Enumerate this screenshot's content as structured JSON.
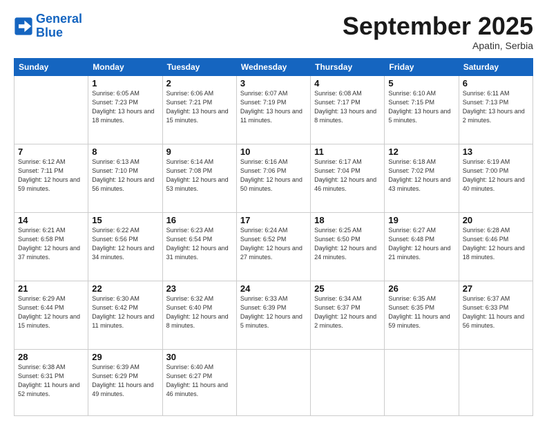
{
  "logo": {
    "line1": "General",
    "line2": "Blue"
  },
  "title": "September 2025",
  "location": "Apatin, Serbia",
  "weekdays": [
    "Sunday",
    "Monday",
    "Tuesday",
    "Wednesday",
    "Thursday",
    "Friday",
    "Saturday"
  ],
  "weeks": [
    [
      {
        "day": "",
        "empty": true
      },
      {
        "day": "1",
        "sunrise": "6:05 AM",
        "sunset": "7:23 PM",
        "daylight": "13 hours and 18 minutes."
      },
      {
        "day": "2",
        "sunrise": "6:06 AM",
        "sunset": "7:21 PM",
        "daylight": "13 hours and 15 minutes."
      },
      {
        "day": "3",
        "sunrise": "6:07 AM",
        "sunset": "7:19 PM",
        "daylight": "13 hours and 11 minutes."
      },
      {
        "day": "4",
        "sunrise": "6:08 AM",
        "sunset": "7:17 PM",
        "daylight": "13 hours and 8 minutes."
      },
      {
        "day": "5",
        "sunrise": "6:10 AM",
        "sunset": "7:15 PM",
        "daylight": "13 hours and 5 minutes."
      },
      {
        "day": "6",
        "sunrise": "6:11 AM",
        "sunset": "7:13 PM",
        "daylight": "13 hours and 2 minutes."
      }
    ],
    [
      {
        "day": "7",
        "sunrise": "6:12 AM",
        "sunset": "7:11 PM",
        "daylight": "12 hours and 59 minutes."
      },
      {
        "day": "8",
        "sunrise": "6:13 AM",
        "sunset": "7:10 PM",
        "daylight": "12 hours and 56 minutes."
      },
      {
        "day": "9",
        "sunrise": "6:14 AM",
        "sunset": "7:08 PM",
        "daylight": "12 hours and 53 minutes."
      },
      {
        "day": "10",
        "sunrise": "6:16 AM",
        "sunset": "7:06 PM",
        "daylight": "12 hours and 50 minutes."
      },
      {
        "day": "11",
        "sunrise": "6:17 AM",
        "sunset": "7:04 PM",
        "daylight": "12 hours and 46 minutes."
      },
      {
        "day": "12",
        "sunrise": "6:18 AM",
        "sunset": "7:02 PM",
        "daylight": "12 hours and 43 minutes."
      },
      {
        "day": "13",
        "sunrise": "6:19 AM",
        "sunset": "7:00 PM",
        "daylight": "12 hours and 40 minutes."
      }
    ],
    [
      {
        "day": "14",
        "sunrise": "6:21 AM",
        "sunset": "6:58 PM",
        "daylight": "12 hours and 37 minutes."
      },
      {
        "day": "15",
        "sunrise": "6:22 AM",
        "sunset": "6:56 PM",
        "daylight": "12 hours and 34 minutes."
      },
      {
        "day": "16",
        "sunrise": "6:23 AM",
        "sunset": "6:54 PM",
        "daylight": "12 hours and 31 minutes."
      },
      {
        "day": "17",
        "sunrise": "6:24 AM",
        "sunset": "6:52 PM",
        "daylight": "12 hours and 27 minutes."
      },
      {
        "day": "18",
        "sunrise": "6:25 AM",
        "sunset": "6:50 PM",
        "daylight": "12 hours and 24 minutes."
      },
      {
        "day": "19",
        "sunrise": "6:27 AM",
        "sunset": "6:48 PM",
        "daylight": "12 hours and 21 minutes."
      },
      {
        "day": "20",
        "sunrise": "6:28 AM",
        "sunset": "6:46 PM",
        "daylight": "12 hours and 18 minutes."
      }
    ],
    [
      {
        "day": "21",
        "sunrise": "6:29 AM",
        "sunset": "6:44 PM",
        "daylight": "12 hours and 15 minutes."
      },
      {
        "day": "22",
        "sunrise": "6:30 AM",
        "sunset": "6:42 PM",
        "daylight": "12 hours and 11 minutes."
      },
      {
        "day": "23",
        "sunrise": "6:32 AM",
        "sunset": "6:40 PM",
        "daylight": "12 hours and 8 minutes."
      },
      {
        "day": "24",
        "sunrise": "6:33 AM",
        "sunset": "6:39 PM",
        "daylight": "12 hours and 5 minutes."
      },
      {
        "day": "25",
        "sunrise": "6:34 AM",
        "sunset": "6:37 PM",
        "daylight": "12 hours and 2 minutes."
      },
      {
        "day": "26",
        "sunrise": "6:35 AM",
        "sunset": "6:35 PM",
        "daylight": "11 hours and 59 minutes."
      },
      {
        "day": "27",
        "sunrise": "6:37 AM",
        "sunset": "6:33 PM",
        "daylight": "11 hours and 56 minutes."
      }
    ],
    [
      {
        "day": "28",
        "sunrise": "6:38 AM",
        "sunset": "6:31 PM",
        "daylight": "11 hours and 52 minutes."
      },
      {
        "day": "29",
        "sunrise": "6:39 AM",
        "sunset": "6:29 PM",
        "daylight": "11 hours and 49 minutes."
      },
      {
        "day": "30",
        "sunrise": "6:40 AM",
        "sunset": "6:27 PM",
        "daylight": "11 hours and 46 minutes."
      },
      {
        "day": "",
        "empty": true
      },
      {
        "day": "",
        "empty": true
      },
      {
        "day": "",
        "empty": true
      },
      {
        "day": "",
        "empty": true
      }
    ]
  ]
}
